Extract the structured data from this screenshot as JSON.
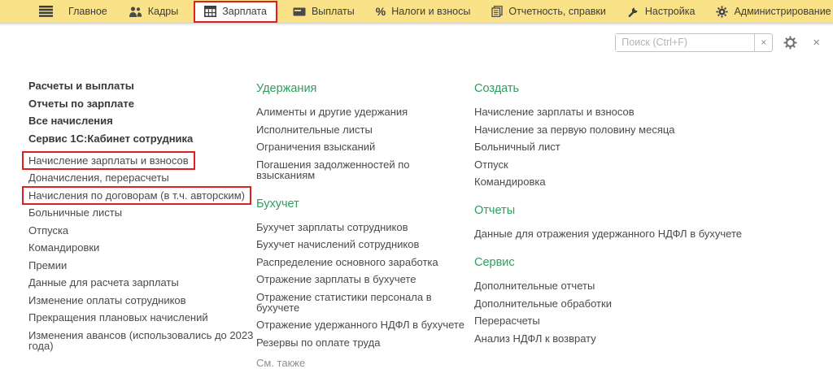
{
  "topbar": {
    "tabs": [
      {
        "label": "Главное"
      },
      {
        "label": "Кадры"
      },
      {
        "label": "Зарплата",
        "active": true,
        "highlighted": true
      },
      {
        "label": "Выплаты"
      },
      {
        "label": "Налоги и взносы"
      },
      {
        "label": "Отчетность, справки"
      },
      {
        "label": "Настройка"
      },
      {
        "label": "Администрирование"
      }
    ],
    "percent_glyph": "%"
  },
  "toolbar": {
    "search_placeholder": "Поиск (Ctrl+F)",
    "clear_glyph": "×",
    "close_glyph": "×"
  },
  "colors": {
    "topbar_bg": "#fae289",
    "highlight_red": "#e01f1f",
    "header_green": "#2e9e5c",
    "link_gray": "#4a4a4a"
  },
  "columns": {
    "left": {
      "bold_items": [
        {
          "label": "Расчеты и выплаты"
        },
        {
          "label": "Отчеты по зарплате"
        },
        {
          "label": "Все начисления"
        },
        {
          "label": "Сервис 1С:Кабинет сотрудника"
        }
      ],
      "items": [
        {
          "label": "Начисление зарплаты и взносов",
          "highlighted": true
        },
        {
          "label": "Доначисления, перерасчеты"
        },
        {
          "label": "Начисления по договорам (в т.ч. авторским)",
          "highlighted": true
        },
        {
          "label": "Больничные листы"
        },
        {
          "label": "Отпуска"
        },
        {
          "label": "Командировки"
        },
        {
          "label": "Премии"
        },
        {
          "label": "Данные для расчета зарплаты"
        },
        {
          "label": "Изменение оплаты сотрудников"
        },
        {
          "label": "Прекращения плановых начислений"
        },
        {
          "label": "Изменения авансов (использовались до 2023 года)"
        }
      ]
    },
    "middle": {
      "sections": [
        {
          "title": "Удержания",
          "items": [
            {
              "label": "Алименты и другие удержания"
            },
            {
              "label": "Исполнительные листы"
            },
            {
              "label": "Ограничения взысканий"
            },
            {
              "label": "Погашения задолженностей по взысканиям"
            }
          ]
        },
        {
          "title": "Бухучет",
          "items": [
            {
              "label": "Бухучет зарплаты сотрудников"
            },
            {
              "label": "Бухучет начислений сотрудников"
            },
            {
              "label": "Распределение основного заработка"
            },
            {
              "label": "Отражение зарплаты в бухучете"
            },
            {
              "label": "Отражение статистики персонала в бухучете"
            },
            {
              "label": "Отражение удержанного НДФЛ в бухучете"
            },
            {
              "label": "Резервы по оплате труда"
            }
          ]
        }
      ],
      "see_also": "См. также"
    },
    "right": {
      "sections": [
        {
          "title": "Создать",
          "items": [
            {
              "label": "Начисление зарплаты и взносов"
            },
            {
              "label": "Начисление за первую половину месяца"
            },
            {
              "label": "Больничный лист"
            },
            {
              "label": "Отпуск"
            },
            {
              "label": "Командировка"
            }
          ]
        },
        {
          "title": "Отчеты",
          "items": [
            {
              "label": "Данные для отражения удержанного НДФЛ в бухучете"
            }
          ]
        },
        {
          "title": "Сервис",
          "items": [
            {
              "label": "Дополнительные отчеты"
            },
            {
              "label": "Дополнительные обработки"
            },
            {
              "label": "Перерасчеты"
            },
            {
              "label": "Анализ НДФЛ к возврату"
            }
          ]
        }
      ]
    }
  }
}
